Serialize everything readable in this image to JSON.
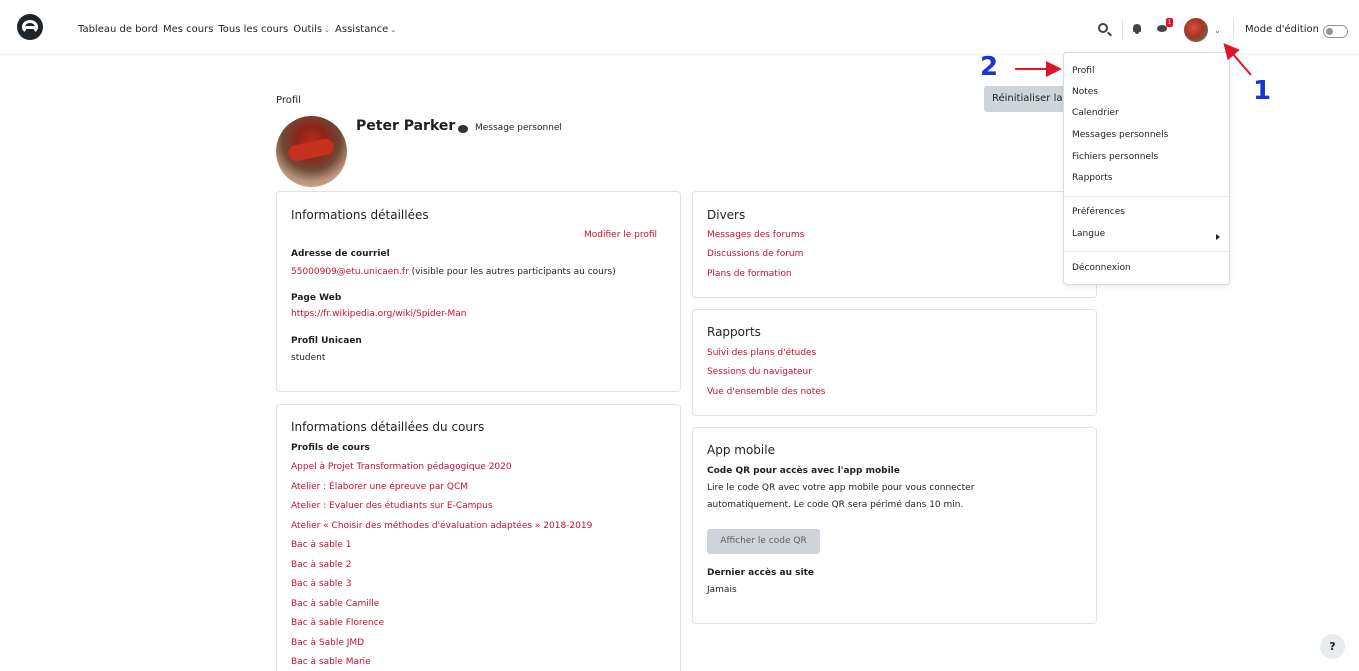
{
  "nav": {
    "links": [
      "Tableau de bord",
      "Mes cours",
      "Tous les cours",
      "Outils",
      "Assistance"
    ],
    "message_badge": "1",
    "edit_mode_label": "Mode d'édition",
    "edit_mode_on": false
  },
  "header": {
    "breadcrumb": "Profil",
    "reset_button": "Réinitialiser la page par défaut",
    "user_name": "Peter Parker",
    "message_link": "Message personnel"
  },
  "details": {
    "title": "Informations détaillées",
    "edit_link": "Modifier le profil",
    "email_label": "Adresse de courriel",
    "email_value": "55000909@etu.unicaen.fr",
    "email_note": " (visible pour les autres participants au cours)",
    "web_label": "Page Web",
    "web_value": "https://fr.wikipedia.org/wiki/Spider-Man",
    "profile_label": "Profil Unicaen",
    "profile_value": "student"
  },
  "course_details": {
    "title": "Informations détaillées du cours",
    "profiles_label": "Profils de cours",
    "courses": [
      "Appel à Projet Transformation pédagogique 2020",
      "Atelier : Élaborer une épreuve par QCM",
      "Atelier : Evaluer des étudiants sur E-Campus",
      "Atelier « Choisir des méthodes d'évaluation adaptées » 2018-2019",
      "Bac à sable 1",
      "Bac à sable 2",
      "Bac à sable 3",
      "Bac à sable Camille",
      "Bac à sable Florence",
      "Bac à Sable JMD",
      "Bac à sable Marie"
    ]
  },
  "divers": {
    "title": "Divers",
    "links": [
      "Messages des forums",
      "Discussions de forum",
      "Plans de formation"
    ]
  },
  "rapports": {
    "title": "Rapports",
    "links": [
      "Suivi des plans d'études",
      "Sessions du navigateur",
      "Vue d'ensemble des notes"
    ]
  },
  "app_mobile": {
    "title": "App mobile",
    "qr_label": "Code QR pour accès avec l'app mobile",
    "qr_text_1": "Lire le code QR avec votre app mobile pour vous connecter",
    "qr_text_2": "automatiquement. Le code QR sera périmé dans 10 min.",
    "qr_button": "Afficher le code QR",
    "last_access_label": "Dernier accès au site",
    "last_access_value": "Jamais"
  },
  "user_menu": {
    "group1": [
      "Profil",
      "Notes",
      "Calendrier",
      "Messages personnels",
      "Fichiers personnels",
      "Rapports"
    ],
    "group2": [
      "Préférences",
      "Langue"
    ],
    "group3": [
      "Déconnexion"
    ]
  },
  "annotations": {
    "step1": "1",
    "step2": "2",
    "color": "#1a35d6",
    "arrow_color": "#e0142b"
  },
  "help_button": "?",
  "colors": {
    "link": "#c8102e",
    "text": "#1d2125",
    "button_grey": "#ced4da"
  }
}
